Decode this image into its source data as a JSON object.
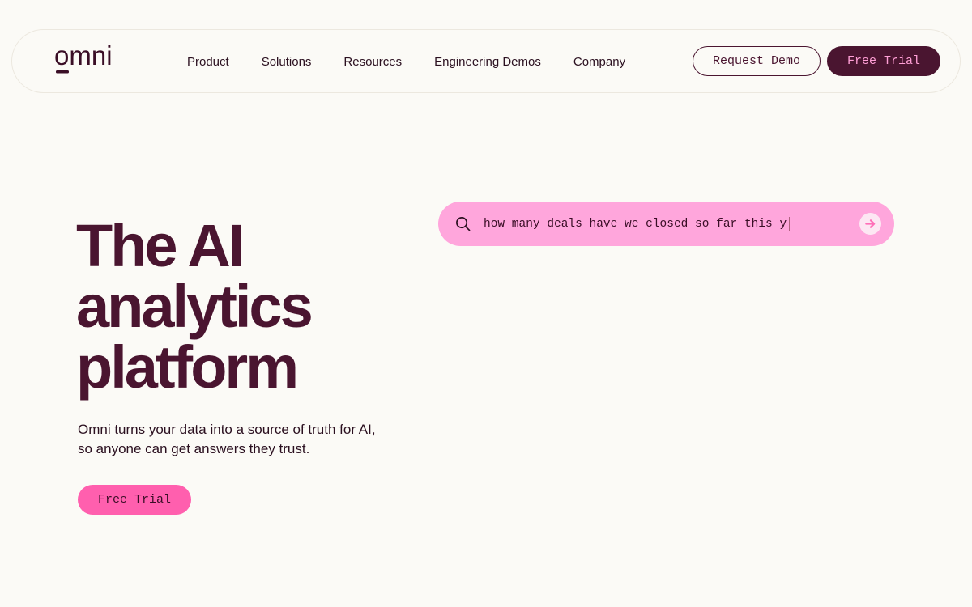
{
  "brand": {
    "logo_text": "omni"
  },
  "nav": {
    "links": [
      "Product",
      "Solutions",
      "Resources",
      "Engineering Demos",
      "Company"
    ],
    "request_demo_label": "Request Demo",
    "free_trial_label": "Free Trial"
  },
  "hero": {
    "title_lines": [
      "The AI",
      "analytics",
      "platform"
    ],
    "subtitle": "Omni turns your data into a source of truth for AI, so anyone can get answers they trust.",
    "cta_label": "Free Trial"
  },
  "ai_search": {
    "query": "how many deals have we closed so far this y",
    "icon": "search-icon",
    "submit_icon": "arrow-right-icon"
  },
  "colors": {
    "background": "#fbfaf6",
    "brand_dark": "#4a1530",
    "pink_button": "#ff5fae",
    "search_bar": "#ffa6dc",
    "nav_trial_text": "#ff9fd6"
  }
}
